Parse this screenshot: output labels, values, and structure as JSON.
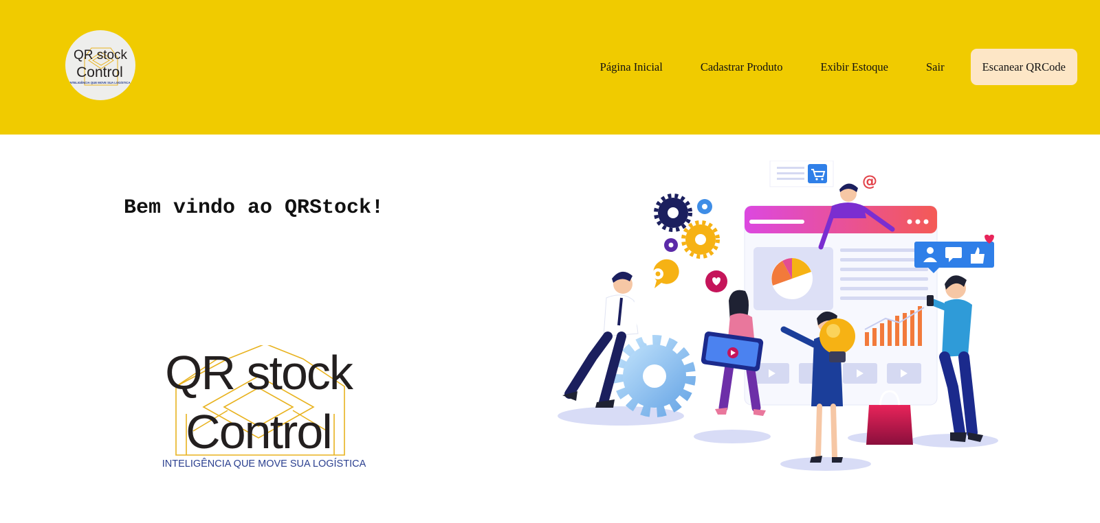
{
  "header": {
    "background_color": "#f0cb00",
    "logo": {
      "line1": "QR stock",
      "line2": "Control",
      "tagline": "INTELIGÊNCIA QUE MOVE SUA LOGÍSTICA"
    },
    "nav": {
      "home": "Página Inicial",
      "register_product": "Cadastrar Produto",
      "show_stock": "Exibir Estoque",
      "logout": "Sair"
    },
    "scan_button": {
      "label": "Escanear QRCode",
      "color": "#fde6c6"
    }
  },
  "main": {
    "welcome_text": "Bem vindo ao QRStock!",
    "logo": {
      "line1": "QR stock",
      "line2": "Control",
      "tagline": "INTELIGÊNCIA QUE MOVE SUA LOGÍSTICA",
      "tagline_color": "#2a3f8f"
    },
    "hero_icons": [
      "gear-icon",
      "cart-icon",
      "at-sign-icon",
      "heart-icon",
      "like-icon",
      "chat-icon",
      "user-icon",
      "lightbulb-icon",
      "pie-chart-icon",
      "bar-chart-icon",
      "shopping-bag-icon",
      "video-play-icon"
    ]
  }
}
